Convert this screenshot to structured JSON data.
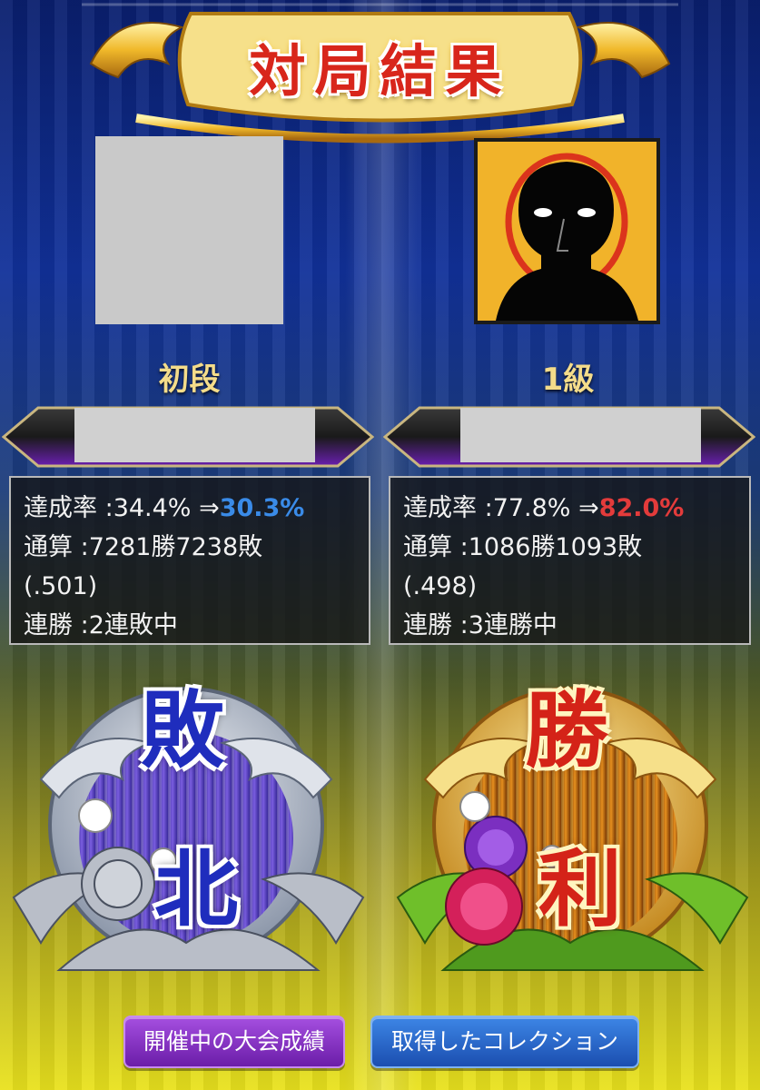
{
  "header": {
    "title": "対局結果"
  },
  "players": {
    "left": {
      "rank": "初段",
      "stats": {
        "rate_label": "達成率",
        "rate_before": ":34.4%",
        "arrow": "⇒",
        "rate_after": "30.3%",
        "record_label": "通算",
        "record": ":7281勝7238敗",
        "record_pct": "(.501)",
        "streak_label": "連勝",
        "streak": ":2連敗中"
      },
      "result": {
        "char_top": "敗",
        "char_bottom": "北"
      }
    },
    "right": {
      "rank": "1級",
      "stats": {
        "rate_label": "達成率",
        "rate_before": ":77.8%",
        "arrow": "⇒",
        "rate_after": "82.0%",
        "record_label": "通算",
        "record": ":1086勝1093敗",
        "record_pct": "(.498)",
        "streak_label": "連勝",
        "streak": ":3連勝中"
      },
      "result": {
        "char_top": "勝",
        "char_bottom": "利"
      }
    }
  },
  "buttons": {
    "tournament_label": "開催中の大会成績",
    "collection_label": "取得したコレクション"
  },
  "colors": {
    "rate_down": "#3a8be8",
    "rate_up": "#e33b3b",
    "title_red": "#d8261b",
    "gold": "#f1b32a"
  }
}
